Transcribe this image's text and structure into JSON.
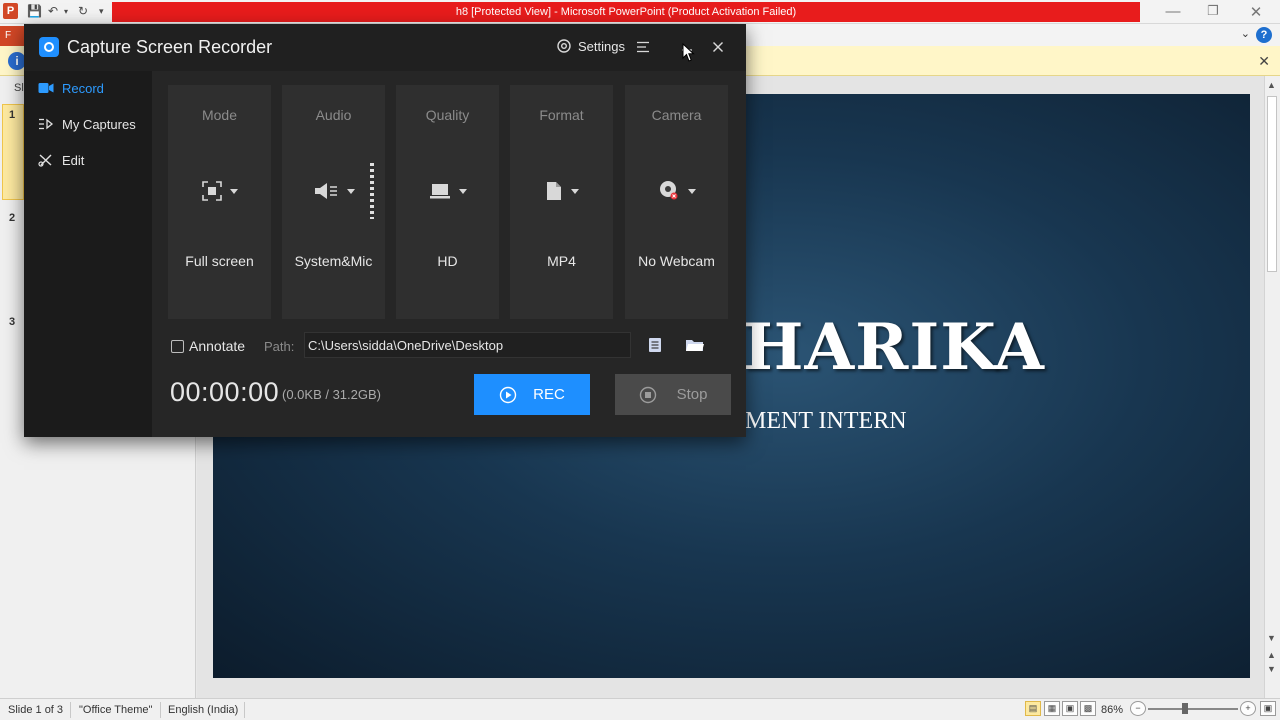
{
  "ppt": {
    "logo_letter": "P",
    "window_title": "h8 [Protected View] - Microsoft PowerPoint (Product Activation Failed)",
    "file_tab": "F",
    "info_icon": "i",
    "left_panel_label": "Sl",
    "slide_numbers": [
      "1",
      "2",
      "3"
    ],
    "slide": {
      "title": "HARIKA",
      "subtitle": "MENT INTERN"
    },
    "status": {
      "slide_info": "Slide 1 of 3",
      "theme": "\"Office Theme\"",
      "language": "English (India)",
      "zoom": "86%"
    }
  },
  "recorder": {
    "title": "Capture Screen Recorder",
    "settings_label": "Settings",
    "sidebar": [
      {
        "label": "Record",
        "icon": "video-camera-icon",
        "active": true
      },
      {
        "label": "My Captures",
        "icon": "list-icon",
        "active": false
      },
      {
        "label": "Edit",
        "icon": "edit-tools-icon",
        "active": false
      }
    ],
    "options": [
      {
        "label": "Mode",
        "value": "Full screen",
        "icon": "fullscreen-icon"
      },
      {
        "label": "Audio",
        "value": "System&Mic",
        "icon": "speaker-icon"
      },
      {
        "label": "Quality",
        "value": "HD",
        "icon": "monitor-icon"
      },
      {
        "label": "Format",
        "value": "MP4",
        "icon": "file-icon"
      },
      {
        "label": "Camera",
        "value": "No Webcam",
        "icon": "webcam-icon"
      }
    ],
    "annotate_label": "Annotate",
    "path_label": "Path:",
    "path_value": "C:\\Users\\sidda\\OneDrive\\Desktop",
    "timer": "00:00:00",
    "storage": "(0.0KB / 31.2GB)",
    "rec_label": "REC",
    "stop_label": "Stop",
    "colors": {
      "accent": "#1e8fff",
      "background": "#1b1b1b",
      "card": "#2f2f2f"
    }
  }
}
